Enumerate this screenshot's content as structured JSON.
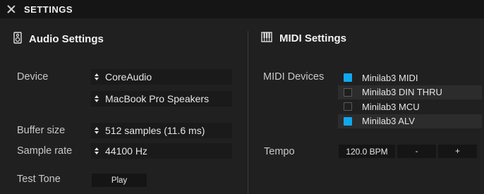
{
  "window": {
    "title": "SETTINGS"
  },
  "audio": {
    "heading": "Audio Settings",
    "device_label": "Device",
    "device_value": "CoreAudio",
    "output_value": "MacBook Pro Speakers",
    "buffer_label": "Buffer size",
    "buffer_value": "512 samples (11.6 ms)",
    "rate_label": "Sample rate",
    "rate_value": "44100 Hz",
    "tone_label": "Test Tone",
    "play_label": "Play"
  },
  "midi": {
    "heading": "MIDI Settings",
    "devices_label": "MIDI Devices",
    "devices": [
      {
        "name": "Minilab3 MIDI",
        "checked": true
      },
      {
        "name": "Minilab3 DIN THRU",
        "checked": false
      },
      {
        "name": "Minilab3 MCU",
        "checked": false
      },
      {
        "name": "Minilab3 ALV",
        "checked": true
      }
    ],
    "tempo_label": "Tempo",
    "tempo_value": "120.0 BPM",
    "minus_label": "-",
    "plus_label": "+"
  },
  "colors": {
    "accent": "#10a8ef",
    "background": "#202020",
    "titlebar": "#151515"
  },
  "icons": {
    "close": "close-icon",
    "audio": "speaker-icon",
    "midi": "piano-keys-icon",
    "stepper": "updown-icon"
  }
}
